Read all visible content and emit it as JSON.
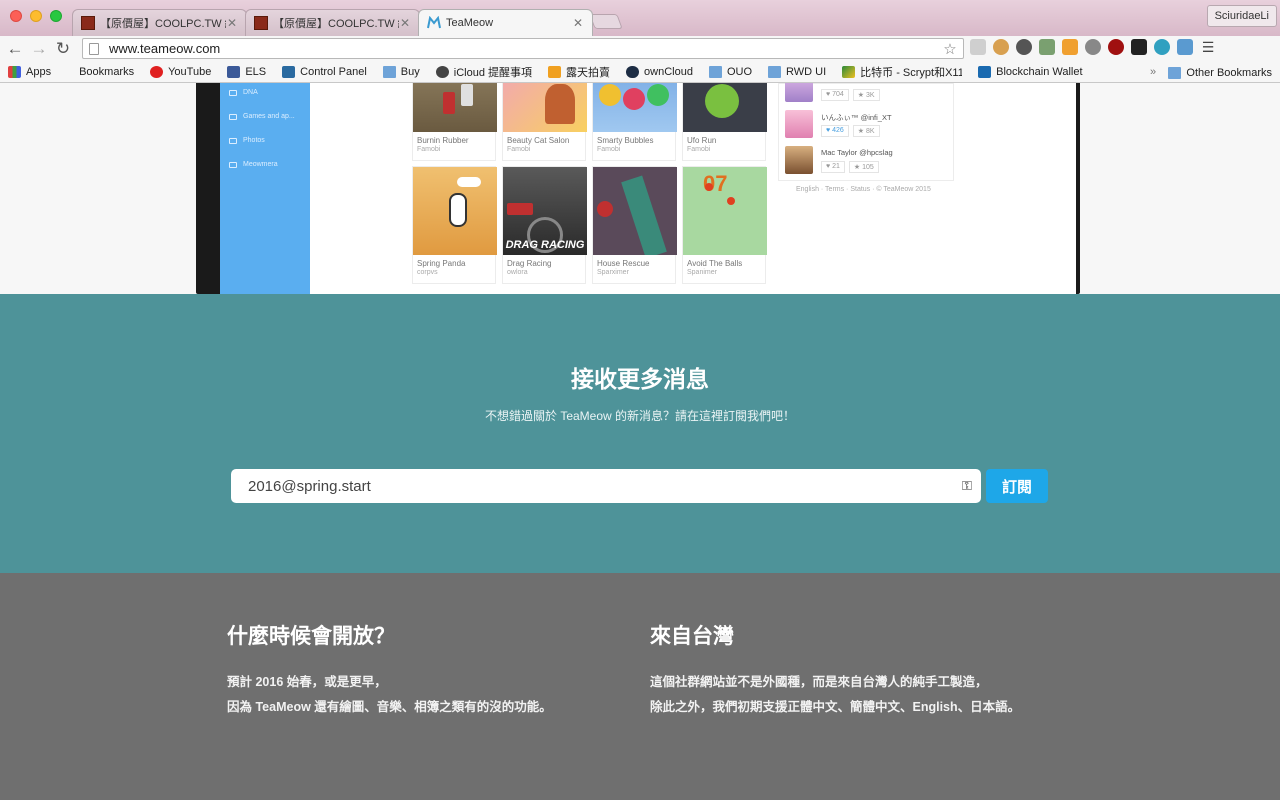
{
  "browser": {
    "tabs": [
      {
        "title": "【原價屋】COOLPC.TW 線..."
      },
      {
        "title": "【原價屋】COOLPC.TW 線..."
      },
      {
        "title": "TeaMeow"
      }
    ],
    "profile": "SciuridaeLi",
    "url": "www.teameow.com",
    "bookmarks": [
      {
        "label": "Apps",
        "icon": "apps-grid-icon"
      },
      {
        "label": "Bookmarks",
        "icon": "bookmark-icon"
      },
      {
        "label": "YouTube",
        "icon": "youtube-icon"
      },
      {
        "label": "ELS",
        "icon": "facebook-icon"
      },
      {
        "label": "Control Panel",
        "icon": "control-panel-icon"
      },
      {
        "label": "Buy",
        "icon": "folder-icon"
      },
      {
        "label": "iCloud 提醒事項",
        "icon": "apple-icon"
      },
      {
        "label": "露天拍賣",
        "icon": "ruten-icon"
      },
      {
        "label": "ownCloud",
        "icon": "owncloud-icon"
      },
      {
        "label": "OUO",
        "icon": "folder-icon"
      },
      {
        "label": "RWD UI",
        "icon": "folder-icon"
      },
      {
        "label": "比特币 - Scrypt和X11",
        "icon": "chart-icon"
      },
      {
        "label": "Blockchain Wallet",
        "icon": "blockchain-icon"
      }
    ],
    "other_bookmarks": "Other Bookmarks",
    "overflow": "»"
  },
  "preview": {
    "sidebar_items": [
      "DNA",
      "Games and ap...",
      "Photos",
      "Meowmera"
    ],
    "games": [
      {
        "name": "Burnin Rubber",
        "author": "Famobi"
      },
      {
        "name": "Beauty Cat Salon",
        "author": "Famobi"
      },
      {
        "name": "Smarty Bubbles",
        "author": "Famobi"
      },
      {
        "name": "Ufo Run",
        "author": "Famobi"
      },
      {
        "name": "Spring Panda",
        "author": "corpvs"
      },
      {
        "name": "Drag Racing",
        "author": "owlora"
      },
      {
        "name": "House Rescue",
        "author": "Sparximer"
      },
      {
        "name": "Avoid The Balls",
        "author": "Spanimer"
      }
    ],
    "drag_racing_text": "DRAG RACING",
    "users": [
      {
        "name": "",
        "likes": "704",
        "stars": "3K"
      },
      {
        "name": "いんふぃ™ @infi_XT",
        "likes": "426",
        "stars": "8K"
      },
      {
        "name": "Mac Taylor @hpcslag",
        "likes": "21",
        "stars": "105"
      }
    ],
    "footer": "English · Terms · Status · © TeaMeow 2015"
  },
  "subscribe": {
    "title": "接收更多消息",
    "description": "不想錯過關於 TeaMeow 的新消息？請在這裡訂閱我們吧！",
    "input_value": "2016@spring.start",
    "button_label": "訂閱"
  },
  "info": {
    "when": {
      "title": "什麼時候會開放？",
      "line1": "預計 2016 始春，或是更早，",
      "line2": "因為 TeaMeow 還有繪圖、音樂、相簿之類有的沒的功能。"
    },
    "taiwan": {
      "title": "來自台灣",
      "line1": "這個社群網站並不是外國種，而是來自台灣人的純手工製造，",
      "line2": "除此之外，我們初期支援正體中文、簡體中文、English、日本語。"
    }
  },
  "colors": {
    "subscribe_bg": "#4e9399",
    "info_bg": "#6f6f6f",
    "button_bg": "#1ea7e8",
    "sidebar_bg": "#5aaef0"
  }
}
